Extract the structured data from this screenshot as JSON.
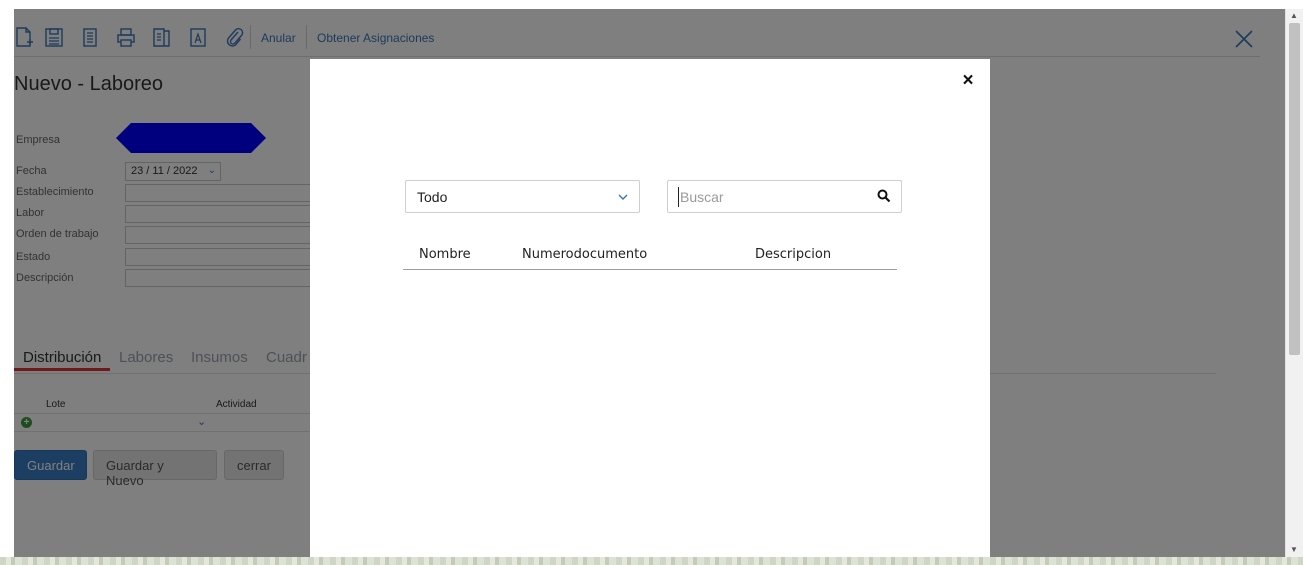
{
  "toolbar": {
    "icons": [
      "new-document-icon",
      "save-icon",
      "copy-icon",
      "print-icon",
      "report-icon",
      "font-icon",
      "attachment-icon"
    ],
    "anular_label": "Anular",
    "obtener_label": "Obtener Asignaciones"
  },
  "form": {
    "title": "Nuevo - Laboreo",
    "labels": {
      "empresa": "Empresa",
      "fecha": "Fecha",
      "establecimiento": "Establecimiento",
      "labor": "Labor",
      "orden": "Orden de trabajo",
      "estado": "Estado",
      "descripcion": "Descripción"
    },
    "fecha_value": "23 / 11 /  2022",
    "redaction_color": "#0000ff"
  },
  "tabs": {
    "items": [
      "Distribución",
      "Labores",
      "Insumos",
      "Cuadr"
    ],
    "active": "Distribución",
    "active_color": "#e0333a"
  },
  "grid": {
    "columns": [
      "Lote",
      "Actividad"
    ]
  },
  "buttons": {
    "guardar": "Guardar",
    "guardar_nuevo": "Guardar y Nuevo",
    "cerrar": "cerrar",
    "primary_color": "#3a7cc7"
  },
  "modal": {
    "close_symbol": "×",
    "filter": {
      "selected": "Todo"
    },
    "search": {
      "placeholder": "Buscar",
      "value": ""
    },
    "table": {
      "columns": [
        "Nombre",
        "Numerodocumento",
        "Descripcion"
      ],
      "rows": []
    }
  }
}
